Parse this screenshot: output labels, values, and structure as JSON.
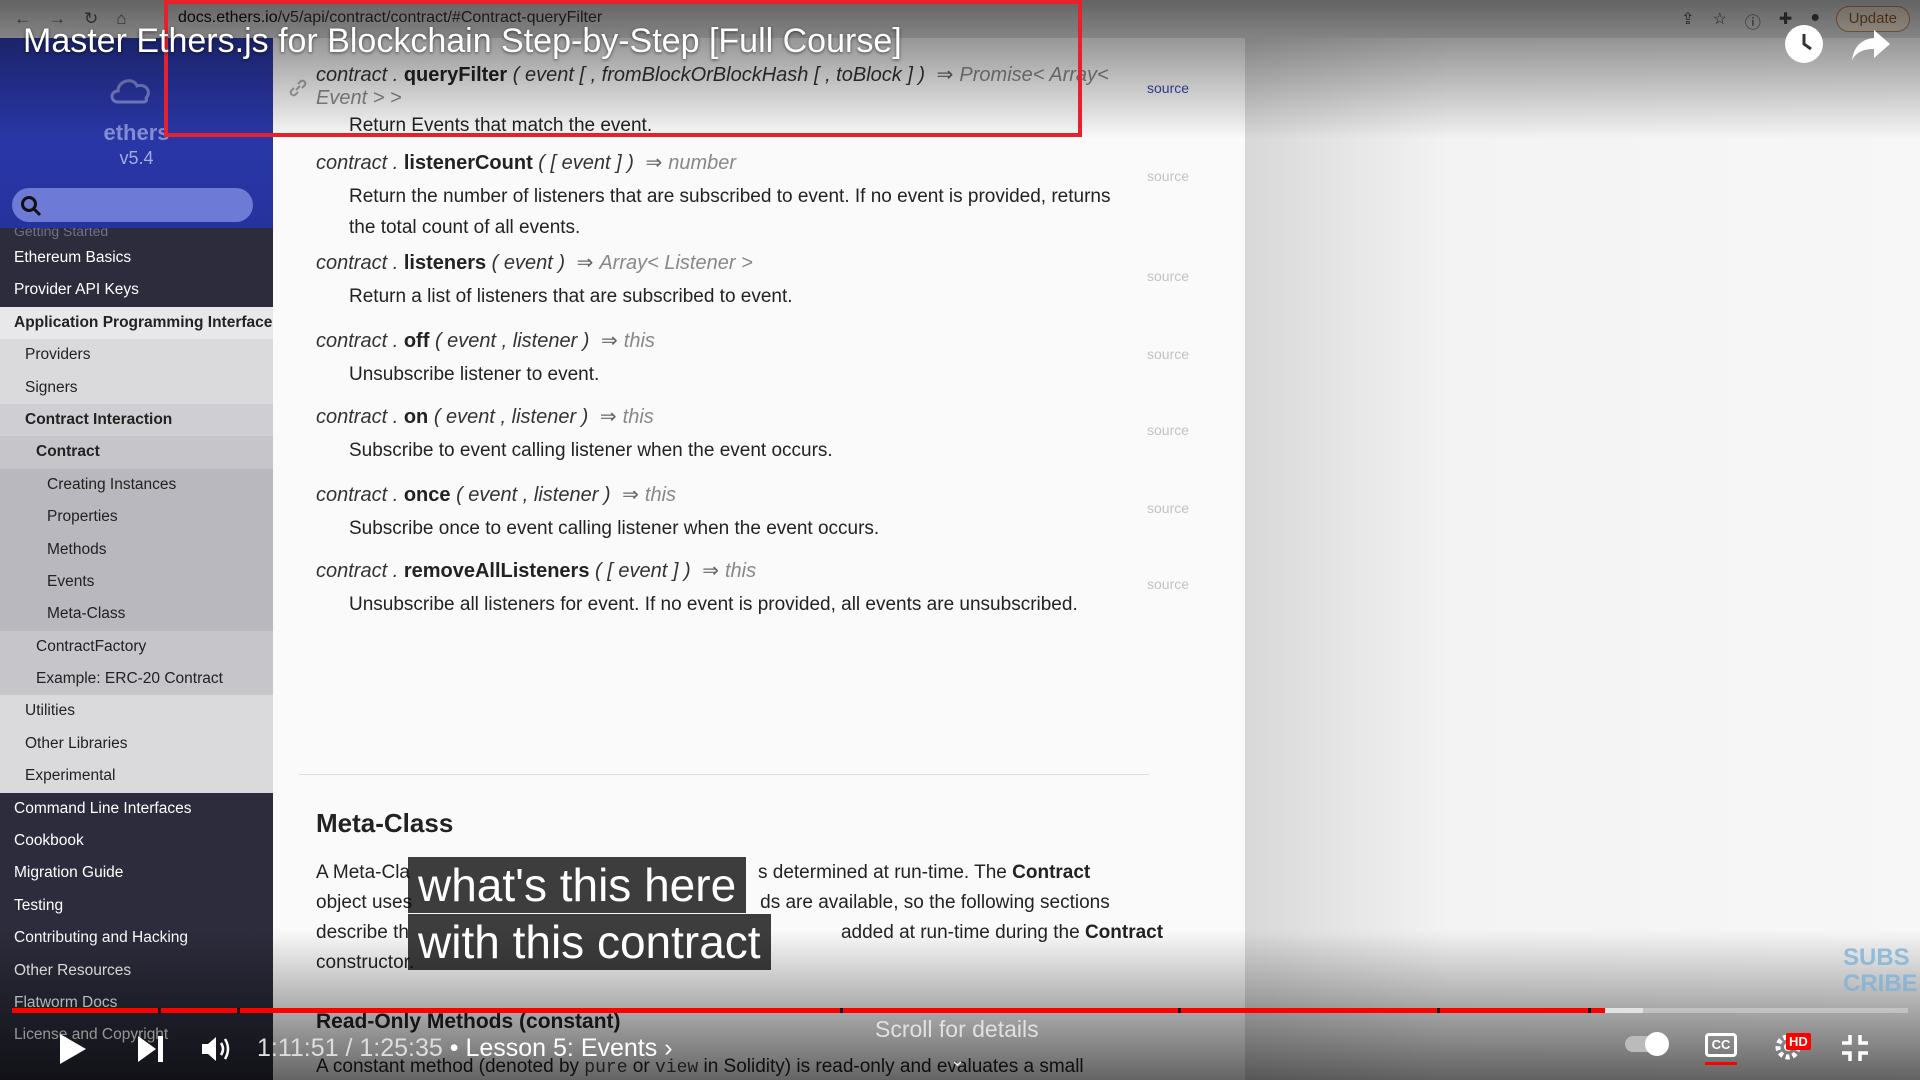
{
  "browser": {
    "url_host": "docs.ethers.io",
    "url_path": "/v5/api/contract/contract/#Contract-queryFilter",
    "update_label": "Update"
  },
  "sidebar": {
    "brand_name": "ethers",
    "version": "v5.4",
    "faded_item": "Getting Started",
    "items": [
      {
        "label": "Ethereum Basics",
        "level": "top"
      },
      {
        "label": "Provider API Keys",
        "level": "top"
      },
      {
        "label": "Application Programming Interface",
        "level": "l1"
      },
      {
        "label": "Providers",
        "level": "l2n"
      },
      {
        "label": "Signers",
        "level": "l2n"
      },
      {
        "label": "Contract Interaction",
        "level": "l2b"
      },
      {
        "label": "Contract",
        "level": "l3b"
      },
      {
        "label": "Creating Instances",
        "level": "l4"
      },
      {
        "label": "Properties",
        "level": "l4"
      },
      {
        "label": "Methods",
        "level": "l4"
      },
      {
        "label": "Events",
        "level": "l4"
      },
      {
        "label": "Meta-Class",
        "level": "l4"
      },
      {
        "label": "ContractFactory",
        "level": "l3n"
      },
      {
        "label": "Example: ERC-20 Contract",
        "level": "l3n"
      },
      {
        "label": "Utilities",
        "level": "l2n"
      },
      {
        "label": "Other Libraries",
        "level": "l2n"
      },
      {
        "label": "Experimental",
        "level": "l2n"
      },
      {
        "label": "Command Line Interfaces",
        "level": "top"
      },
      {
        "label": "Cookbook",
        "level": "top"
      },
      {
        "label": "Migration Guide",
        "level": "top"
      },
      {
        "label": "Testing",
        "level": "top"
      },
      {
        "label": "Contributing and Hacking",
        "level": "top"
      },
      {
        "label": "Other Resources",
        "level": "top"
      },
      {
        "label": "Flatworm Docs",
        "level": "top"
      },
      {
        "label": "License and Copyright",
        "level": "top"
      }
    ]
  },
  "doc": {
    "source_label": "source",
    "entries": [
      {
        "pre": "contract .",
        "method": "queryFilter",
        "params": "( event [ , fromBlockOrBlockHash [ , toBlock ] ) ",
        "ret": "Promise< Array<",
        "ret2": "Event > >",
        "desc": "Return Events that match the event."
      },
      {
        "pre": "contract .",
        "method": "listenerCount",
        "params": "( [ event ] ) ",
        "ret": "number",
        "desc": "Return the number of listeners that are subscribed to event. If no event is provided, returns",
        "desc2": "the total count of all events."
      },
      {
        "pre": "contract .",
        "method": "listeners",
        "params": "( event ) ",
        "ret": "Array< Listener >",
        "desc": "Return a list of listeners that are subscribed to event."
      },
      {
        "pre": "contract .",
        "method": "off",
        "params": "( event , listener ) ",
        "ret": "this",
        "desc": "Unsubscribe listener to event."
      },
      {
        "pre": "contract .",
        "method": "on",
        "params": "( event , listener ) ",
        "ret": "this",
        "desc": "Subscribe to event calling listener when the event occurs."
      },
      {
        "pre": "contract .",
        "method": "once",
        "params": "( event , listener ) ",
        "ret": "this",
        "desc": "Subscribe once to event calling listener when the event occurs."
      },
      {
        "pre": "contract .",
        "method": "removeAllListeners",
        "params": "( [ event ] ) ",
        "ret": "this",
        "desc": "Unsubscribe all listeners for event. If no event is provided, all events are unsubscribed."
      }
    ],
    "arrow": "⇒",
    "meta_heading": "Meta-Class",
    "meta_line1_a": "A Meta-Cla",
    "meta_line1_b": "s determined at run-time. The ",
    "meta_line1_bold": "Contract",
    "meta_line2_a": "object uses",
    "meta_line2_b": "ds are available, so the following sections",
    "meta_line3_a": "describe th",
    "meta_line3_b": "added at run-time during the ",
    "meta_line3_bold": "Contract",
    "meta_line4": "constructor.",
    "readonly_heading": "Read-Only Methods (constant)",
    "readonly_para_a": "A constant method (denoted by ",
    "readonly_code1": "pure",
    "readonly_para_b": " or ",
    "readonly_code2": "view",
    "readonly_para_c": " in Solidity) is read-only and evaluates a small"
  },
  "video": {
    "title": "Master Ethers.js for Blockchain Step-by-Step [Full Course]",
    "caption_line1": "what's this here",
    "caption_line2": "with this contract",
    "time": "1:11:51 / 1:25:35",
    "chapter": "• Lesson 5: Events ›",
    "scroll_hint": "Scroll for details",
    "subscribe_watermark": "SUBS CRIBE",
    "progress_played_fraction": 0.84,
    "progress_buffered_fraction": 0.86
  }
}
